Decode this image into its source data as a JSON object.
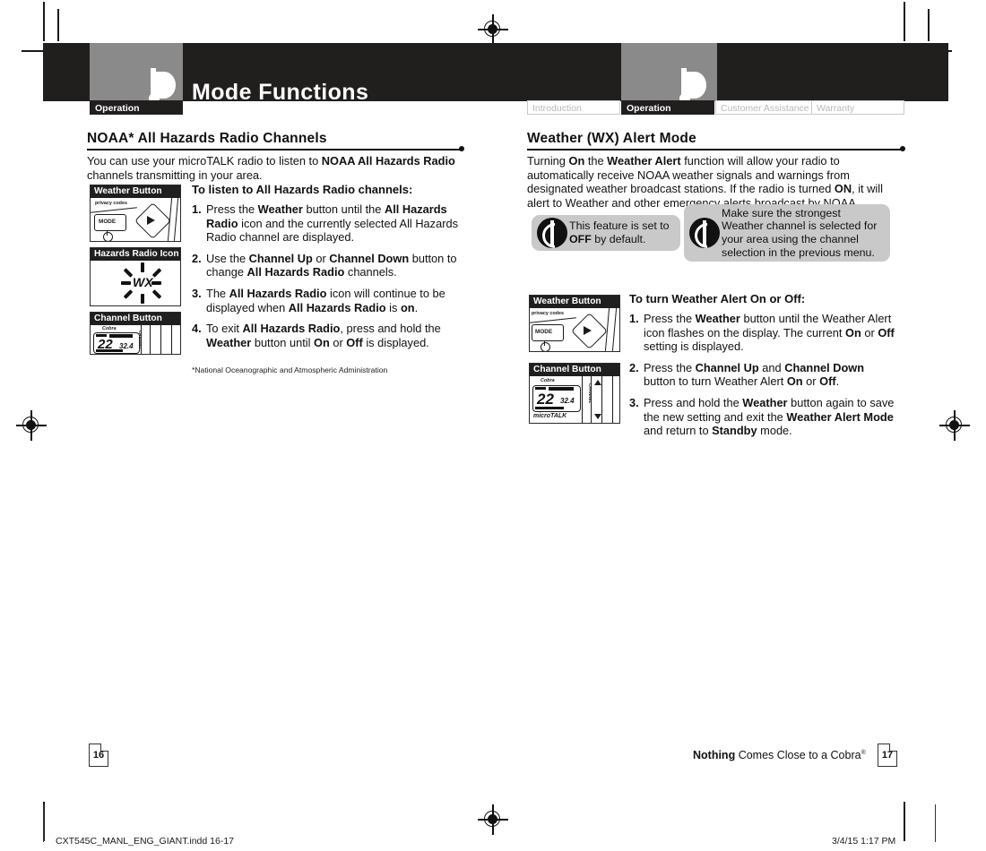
{
  "header": {
    "title": "Mode Functions",
    "logo_name": "cobra-logo",
    "left_tab": "Operation",
    "tabs": [
      {
        "label": "Introduction",
        "active": false
      },
      {
        "label": "Operation",
        "active": true
      },
      {
        "label": "Customer Assistance",
        "active": false
      },
      {
        "label": "Warranty",
        "active": false
      }
    ]
  },
  "left_page": {
    "heading": "NOAA* All Hazards Radio Channels",
    "intro_1": "You can use your microTALK radio to listen to ",
    "intro_bold": "NOAA All Hazards Radio",
    "intro_2": " channels transmitting in your area.",
    "lede": "To listen to All Hazards Radio channels:",
    "steps": [
      {
        "num": "1.",
        "text": "Press the Weather button until the All Hazards Radio icon and the currently selected All Hazards Radio channel are displayed."
      },
      {
        "num": "2.",
        "text": "Use the Channel Up or Channel Down button to change All Hazards Radio channels."
      },
      {
        "num": "3.",
        "text": "The All Hazards Radio icon will continue to be displayed when All Hazards Radio is on."
      },
      {
        "num": "4.",
        "text": "To exit All Hazards Radio, press and hold the Weather button until On or Off is displayed."
      }
    ],
    "footnote": "*National Oceanographic and Atmospheric Administration",
    "figures": [
      {
        "caption": "Weather Button",
        "art": "weather-button"
      },
      {
        "caption": "Hazards Radio Icon",
        "art": "wx-starburst"
      },
      {
        "caption": "Channel Button",
        "art": "channel-button"
      }
    ],
    "figure_labels": {
      "privacy_codes": "privacy codes",
      "mode": "MODE",
      "wx": "WX",
      "brand": "Cobra",
      "microtalk": "microTALK",
      "channel_text": "CHANNEL",
      "memory_text": "MEMORY / SCAN",
      "lcd_channel": "22",
      "lcd_sub": "32.4"
    }
  },
  "right_page": {
    "heading": "Weather (WX) Alert Mode",
    "body": "Turning On the Weather Alert function will allow your radio to automatically receive NOAA weather signals and warnings from designated weather broadcast stations.  If the radio is turned ON, it will alert to Weather and other emergency alerts broadcast by NOAA.",
    "callouts": [
      {
        "text": "This feature is set to OFF by default.",
        "icon": "note-icon"
      },
      {
        "text": "Make sure the strongest Weather channel is selected for your area using the channel selection in the previous menu.",
        "icon": "note-icon"
      }
    ],
    "lede": "To turn Weather Alert On or Off:",
    "steps": [
      {
        "num": "1.",
        "text": "Press the Weather button until the Weather Alert icon flashes on the display.  The current On or Off setting is displayed."
      },
      {
        "num": "2.",
        "text": "Press the Channel Up and Channel Down button to turn Weather Alert On or Off."
      },
      {
        "num": "3.",
        "text": "Press and hold the Weather button again to save the new setting and exit the Weather Alert Mode and return to Standby mode."
      }
    ],
    "figures": [
      {
        "caption": "Weather Button",
        "art": "weather-button"
      },
      {
        "caption": "Channel Button",
        "art": "channel-button"
      }
    ]
  },
  "footer": {
    "page_left": "16",
    "page_right": "17",
    "tagline_bold": "Nothing",
    "tagline_rest": " Comes Close to a Cobra",
    "tagline_mark": "®"
  },
  "print_bar": {
    "filename": "CXT545C_MANL_ENG_GIANT.indd   16-17",
    "timestamp": "3/4/15   1:17 PM"
  },
  "colors": {
    "ink": "#211e1e",
    "gray_panel": "#8a8a8a",
    "callout_gray": "#c9c9c9",
    "tab_inactive_text": "#b9b9b9"
  }
}
